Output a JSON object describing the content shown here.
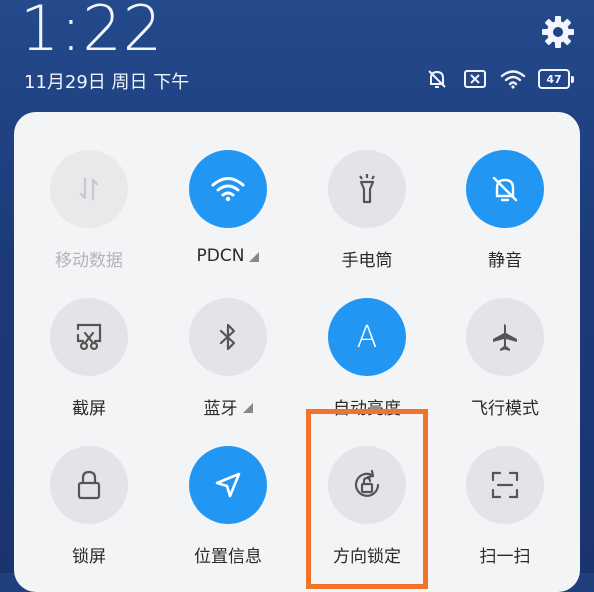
{
  "status_bar": {
    "time": "1:22",
    "date": "11月29日 周日 下午",
    "battery": "47"
  },
  "icons": {
    "settings": "gear-icon",
    "mute_status": "bell-off-icon",
    "sim_status": "no-sim-icon",
    "wifi_status": "wifi-icon"
  },
  "colors": {
    "active": "#2196f3",
    "highlight": "#f0742a",
    "panel": "#f3f4f6"
  },
  "tiles": [
    {
      "label": "移动数据",
      "icon": "mobile-data-icon",
      "state": "disabled"
    },
    {
      "label": "PDCN",
      "icon": "wifi-icon",
      "state": "on"
    },
    {
      "label": "手电筒",
      "icon": "flashlight-icon",
      "state": "off"
    },
    {
      "label": "静音",
      "icon": "bell-off-icon",
      "state": "on"
    },
    {
      "label": "截屏",
      "icon": "screenshot-icon",
      "state": "off"
    },
    {
      "label": "蓝牙",
      "icon": "bluetooth-icon",
      "state": "off"
    },
    {
      "label": "自动亮度",
      "icon": "auto-brightness-icon",
      "glyph": "A",
      "state": "on"
    },
    {
      "label": "飞行模式",
      "icon": "airplane-icon",
      "state": "off"
    },
    {
      "label": "锁屏",
      "icon": "lock-icon",
      "state": "off"
    },
    {
      "label": "位置信息",
      "icon": "location-icon",
      "state": "on"
    },
    {
      "label": "方向锁定",
      "icon": "rotation-lock-icon",
      "state": "off"
    },
    {
      "label": "扫一扫",
      "icon": "scan-icon",
      "state": "off"
    }
  ]
}
